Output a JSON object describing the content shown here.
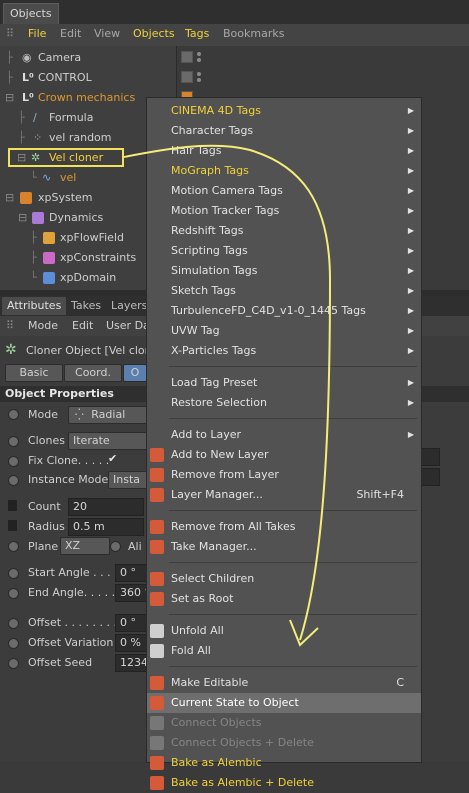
{
  "objects_manager": {
    "tab_title": "Objects",
    "menu": [
      "File",
      "Edit",
      "View",
      "Objects",
      "Tags",
      "Bookmarks"
    ],
    "tree": [
      {
        "label": "Camera"
      },
      {
        "label": "CONTROL"
      },
      {
        "label": "Crown mechanics"
      },
      {
        "label": "Formula"
      },
      {
        "label": "vel random"
      },
      {
        "label": "Vel cloner"
      },
      {
        "label": "vel"
      },
      {
        "label": "xpSystem"
      },
      {
        "label": "Dynamics"
      },
      {
        "label": "xpFlowField"
      },
      {
        "label": "xpConstraints"
      },
      {
        "label": "xpDomain"
      }
    ]
  },
  "attributes": {
    "tabs": [
      "Attributes",
      "Takes",
      "Layers"
    ],
    "menu": [
      "Mode",
      "Edit",
      "User Da"
    ],
    "object_title": "Cloner Object [Vel clon",
    "subtabs": [
      "Basic",
      "Coord.",
      "O"
    ],
    "section_title": "Object Properties",
    "mode_label": "Mode",
    "mode_value": "Radial",
    "clones_label": "Clones",
    "clones_value": "Iterate",
    "fix_clone_label": "Fix Clone. . . . .",
    "fix_clone_check": "✔",
    "instance_mode_label": "Instance Mode",
    "instance_mode_value": "Insta",
    "count_label": "Count",
    "count_value": "20",
    "radius_label": "Radius",
    "radius_value": "0.5 m",
    "plane_label": "Plane",
    "plane_value": "XZ",
    "align_label": "Ali",
    "start_angle_label": "Start Angle . . . .",
    "start_angle_value": "0 °",
    "end_angle_label": "End Angle. . . . .",
    "end_angle_value": "360 °",
    "offset_label": "Offset . . . . . . . .",
    "offset_value": "0 °",
    "offset_variation_label": "Offset Variation",
    "offset_variation_value": "0 %",
    "offset_seed_label": "Offset Seed",
    "offset_seed_value": "1234"
  },
  "context_menu": {
    "items": [
      {
        "label": "CINEMA 4D Tags",
        "submenu": true,
        "style": "yellow"
      },
      {
        "label": "Character Tags",
        "submenu": true
      },
      {
        "label": "Hair Tags",
        "submenu": true
      },
      {
        "label": "MoGraph Tags",
        "submenu": true,
        "style": "yellow"
      },
      {
        "label": "Motion Camera Tags",
        "submenu": true
      },
      {
        "label": "Motion Tracker Tags",
        "submenu": true
      },
      {
        "label": "Redshift Tags",
        "submenu": true
      },
      {
        "label": "Scripting Tags",
        "submenu": true
      },
      {
        "label": "Simulation Tags",
        "submenu": true
      },
      {
        "label": "Sketch Tags",
        "submenu": true
      },
      {
        "label": "TurbulenceFD_C4D_v1-0_1445 Tags",
        "submenu": true
      },
      {
        "label": "UVW Tag",
        "submenu": true
      },
      {
        "label": "X-Particles Tags",
        "submenu": true
      },
      {
        "label": "Load Tag Preset",
        "submenu": true
      },
      {
        "label": "Restore Selection",
        "submenu": true
      },
      {
        "label": "Add to Layer",
        "submenu": true
      },
      {
        "label": "Add to New Layer"
      },
      {
        "label": "Remove from Layer"
      },
      {
        "label": "Layer Manager...",
        "shortcut": "Shift+F4"
      },
      {
        "label": "Remove from All Takes"
      },
      {
        "label": "Take Manager..."
      },
      {
        "label": "Select Children"
      },
      {
        "label": "Set as Root"
      },
      {
        "label": "Unfold All"
      },
      {
        "label": "Fold All"
      },
      {
        "label": "Make Editable",
        "shortcut": "C"
      },
      {
        "label": "Current State to Object",
        "highlighted": true
      },
      {
        "label": "Connect Objects",
        "disabled": true
      },
      {
        "label": "Connect Objects + Delete",
        "disabled": true
      },
      {
        "label": "Bake as Alembic",
        "style": "yellow"
      },
      {
        "label": "Bake as Alembic + Delete",
        "style": "yellow"
      }
    ]
  },
  "colors": {
    "highlight_outline": "#f2e25a",
    "accent_yellow": "#f2d13a",
    "accent_orange": "#e0972e",
    "selected_blue": "#5b7fae"
  }
}
